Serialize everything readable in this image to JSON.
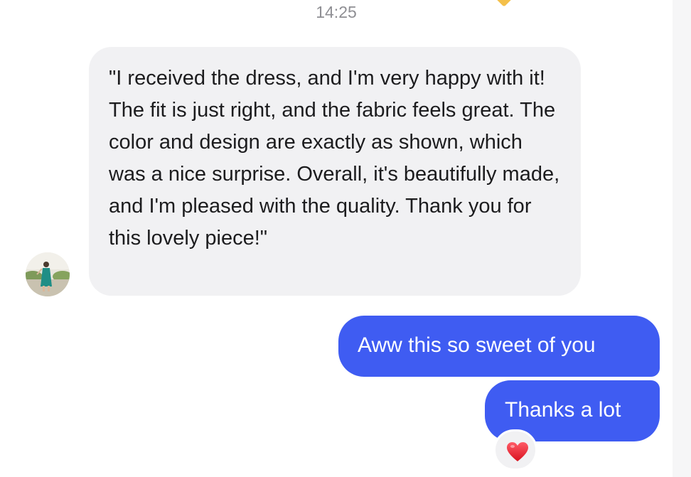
{
  "chat": {
    "timestamp": "14:25",
    "incoming": {
      "sender_avatar": "avatar-photo",
      "text": "\"I received the dress, and I'm very happy with it! The fit is just right, and the fabric feels great. The color and design are exactly as shown, which was a nice surprise. Overall, it's beautifully made, and I'm pleased with the quality. Thank you for this lovely piece!\""
    },
    "outgoing": [
      {
        "text": "Aww this so sweet of you"
      },
      {
        "text": "Thanks a lot"
      }
    ],
    "reaction": {
      "icon": "heart-icon",
      "color": "#e0212f"
    }
  },
  "colors": {
    "outgoing_bubble": "#3f5cf2",
    "incoming_bubble": "#f1f1f3",
    "timestamp_text": "#8e8e93"
  }
}
